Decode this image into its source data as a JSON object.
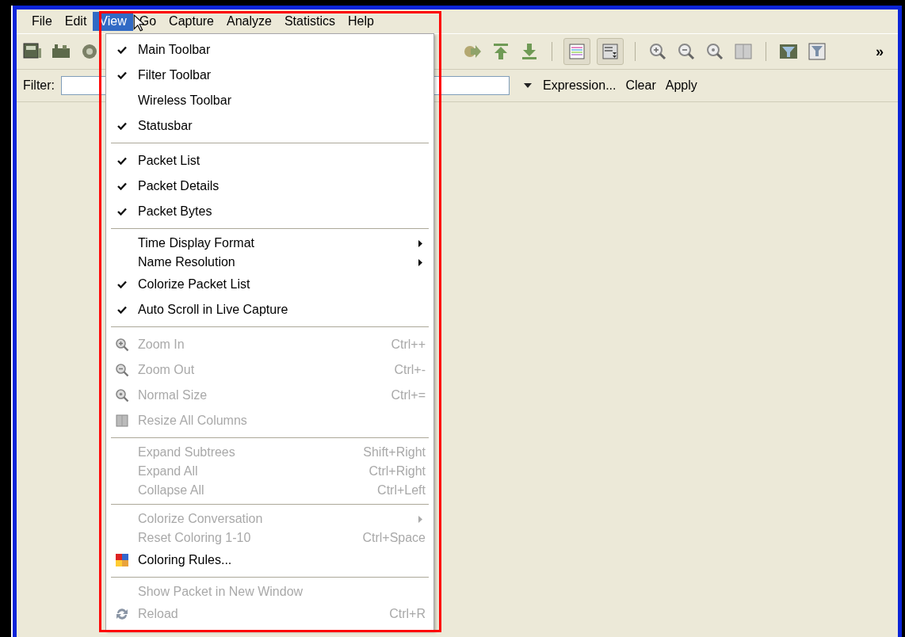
{
  "menubar": [
    {
      "label": "File",
      "selected": false
    },
    {
      "label": "Edit",
      "selected": false
    },
    {
      "label": "View",
      "selected": true
    },
    {
      "label": "Go",
      "selected": false
    },
    {
      "label": "Capture",
      "selected": false
    },
    {
      "label": "Analyze",
      "selected": false
    },
    {
      "label": "Statistics",
      "selected": false
    },
    {
      "label": "Help",
      "selected": false
    }
  ],
  "toolbar": {
    "overflow": "»"
  },
  "filter_bar": {
    "label": "Filter:",
    "links": [
      "Expression...",
      "Clear",
      "Apply"
    ]
  },
  "view_menu": {
    "items": [
      {
        "kind": "check",
        "label": "Main Toolbar",
        "checked": true,
        "disabled": false
      },
      {
        "kind": "check",
        "label": "Filter Toolbar",
        "checked": true,
        "disabled": false
      },
      {
        "kind": "check",
        "label": "Wireless Toolbar",
        "checked": false,
        "disabled": false
      },
      {
        "kind": "check",
        "label": "Statusbar",
        "checked": true,
        "disabled": false
      },
      {
        "kind": "separator"
      },
      {
        "kind": "check",
        "label": "Packet List",
        "checked": true,
        "disabled": false
      },
      {
        "kind": "check",
        "label": "Packet Details",
        "checked": true,
        "disabled": false
      },
      {
        "kind": "check",
        "label": "Packet Bytes",
        "checked": true,
        "disabled": false
      },
      {
        "kind": "separator"
      },
      {
        "kind": "submenu",
        "label": "Time Display Format",
        "disabled": false
      },
      {
        "kind": "submenu",
        "label": "Name Resolution",
        "disabled": false
      },
      {
        "kind": "check",
        "label": "Colorize Packet List",
        "checked": true,
        "disabled": false
      },
      {
        "kind": "check",
        "label": "Auto Scroll in Live Capture",
        "checked": true,
        "disabled": false
      },
      {
        "kind": "separator"
      },
      {
        "kind": "zoom-in",
        "label": "Zoom In",
        "shortcut": "Ctrl++",
        "disabled": true
      },
      {
        "kind": "zoom-out",
        "label": "Zoom Out",
        "shortcut": "Ctrl+-",
        "disabled": true
      },
      {
        "kind": "zoom-reset",
        "label": "Normal Size",
        "shortcut": "Ctrl+=",
        "disabled": true
      },
      {
        "kind": "resize",
        "label": "Resize All Columns",
        "disabled": true
      },
      {
        "kind": "separator"
      },
      {
        "kind": "plain",
        "label": "Expand Subtrees",
        "shortcut": "Shift+Right",
        "disabled": true
      },
      {
        "kind": "plain",
        "label": "Expand All",
        "shortcut": "Ctrl+Right",
        "disabled": true
      },
      {
        "kind": "plain",
        "label": "Collapse All",
        "shortcut": "Ctrl+Left",
        "disabled": true
      },
      {
        "kind": "separator"
      },
      {
        "kind": "submenu",
        "label": "Colorize Conversation",
        "disabled": true
      },
      {
        "kind": "plain",
        "label": "Reset Coloring 1-10",
        "shortcut": "Ctrl+Space",
        "disabled": true
      },
      {
        "kind": "coloring",
        "label": "Coloring Rules...",
        "disabled": false
      },
      {
        "kind": "separator"
      },
      {
        "kind": "plain",
        "label": "Show Packet in New Window",
        "disabled": true
      },
      {
        "kind": "reload",
        "label": "Reload",
        "shortcut": "Ctrl+R",
        "disabled": true
      }
    ]
  }
}
